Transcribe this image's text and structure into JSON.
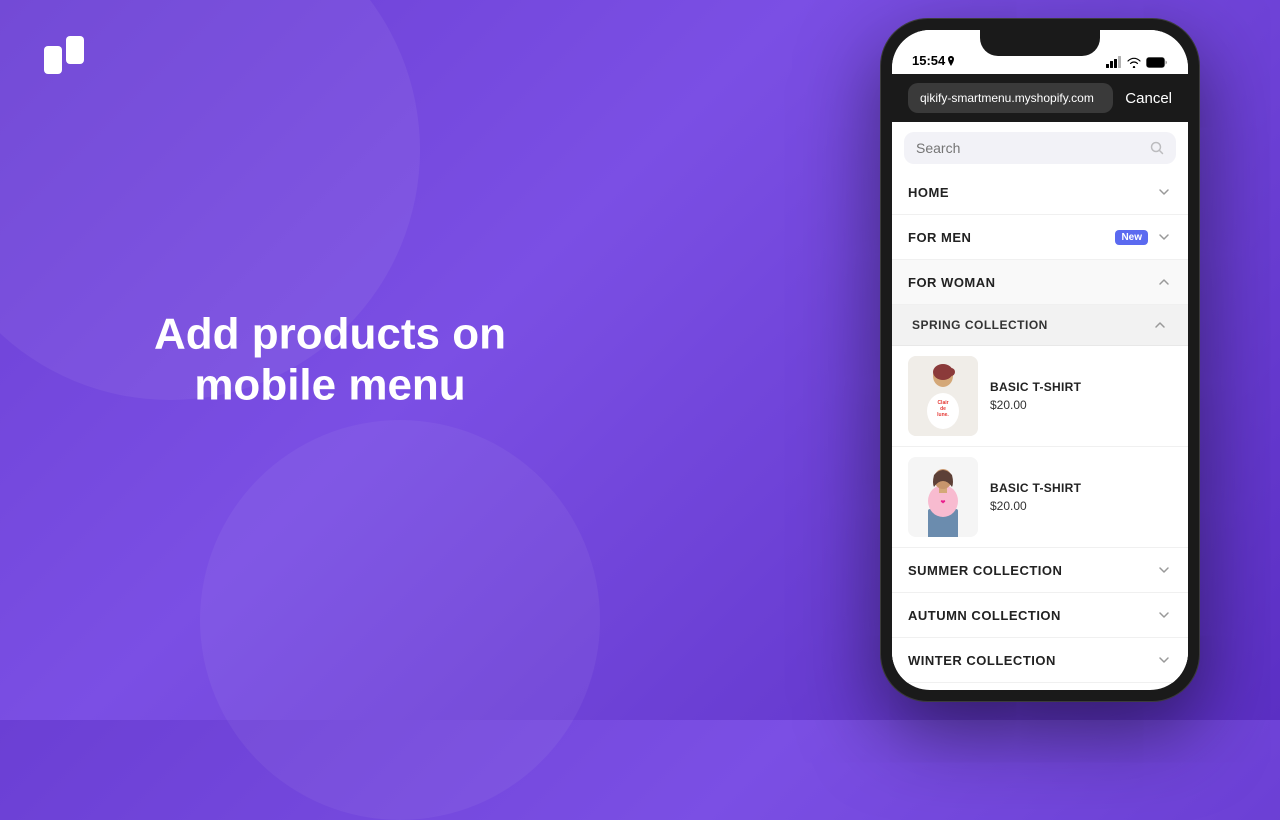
{
  "background": {
    "gradient_start": "#6B3FD4",
    "gradient_end": "#5B2FC4"
  },
  "logo": {
    "alt": "Qikify logo"
  },
  "headline": {
    "line1": "Add products on",
    "line2": "mobile menu"
  },
  "phone": {
    "status_bar": {
      "time": "15:54",
      "signal_icon": "signal-icon",
      "wifi_icon": "wifi-icon",
      "battery_icon": "battery-icon"
    },
    "url_bar": {
      "url": "qikify-smartmenu.myshopify.com",
      "cancel_label": "Cancel"
    },
    "search": {
      "placeholder": "Search"
    },
    "menu": {
      "items": [
        {
          "label": "HOME",
          "badge": null,
          "expanded": false
        },
        {
          "label": "FOR MEN",
          "badge": "New",
          "expanded": false
        }
      ],
      "for_woman": {
        "label": "FOR WOMAN",
        "expanded": true,
        "spring_collection": {
          "label": "SPRING COLLECTION",
          "expanded": true,
          "products": [
            {
              "name": "BASIC T-SHIRT",
              "price": "$20.00",
              "image_alt": "white t-shirt with text"
            },
            {
              "name": "BASIC T-SHIRT",
              "price": "$20.00",
              "image_alt": "pink t-shirt"
            }
          ]
        },
        "other_collections": [
          {
            "label": "SUMMER COLLECTION"
          },
          {
            "label": "AUTUMN COLLECTION"
          },
          {
            "label": "WINTER COLLECTION"
          }
        ]
      }
    }
  }
}
